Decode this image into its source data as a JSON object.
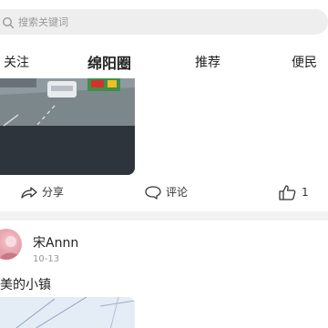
{
  "search": {
    "placeholder": "搜索关键词"
  },
  "tabs": [
    {
      "label": "关注"
    },
    {
      "label": "绵阳圈"
    },
    {
      "label": "推荐"
    },
    {
      "label": "便民"
    }
  ],
  "post1": {
    "actions": {
      "share": "分享",
      "comment": "评论",
      "like_count": "1"
    }
  },
  "post2": {
    "user": "宋Annn",
    "date": "10-13",
    "text": "美的小镇"
  },
  "colors": {
    "accent_text": "#222222",
    "muted": "#999999",
    "divider": "#f2f2f2"
  }
}
